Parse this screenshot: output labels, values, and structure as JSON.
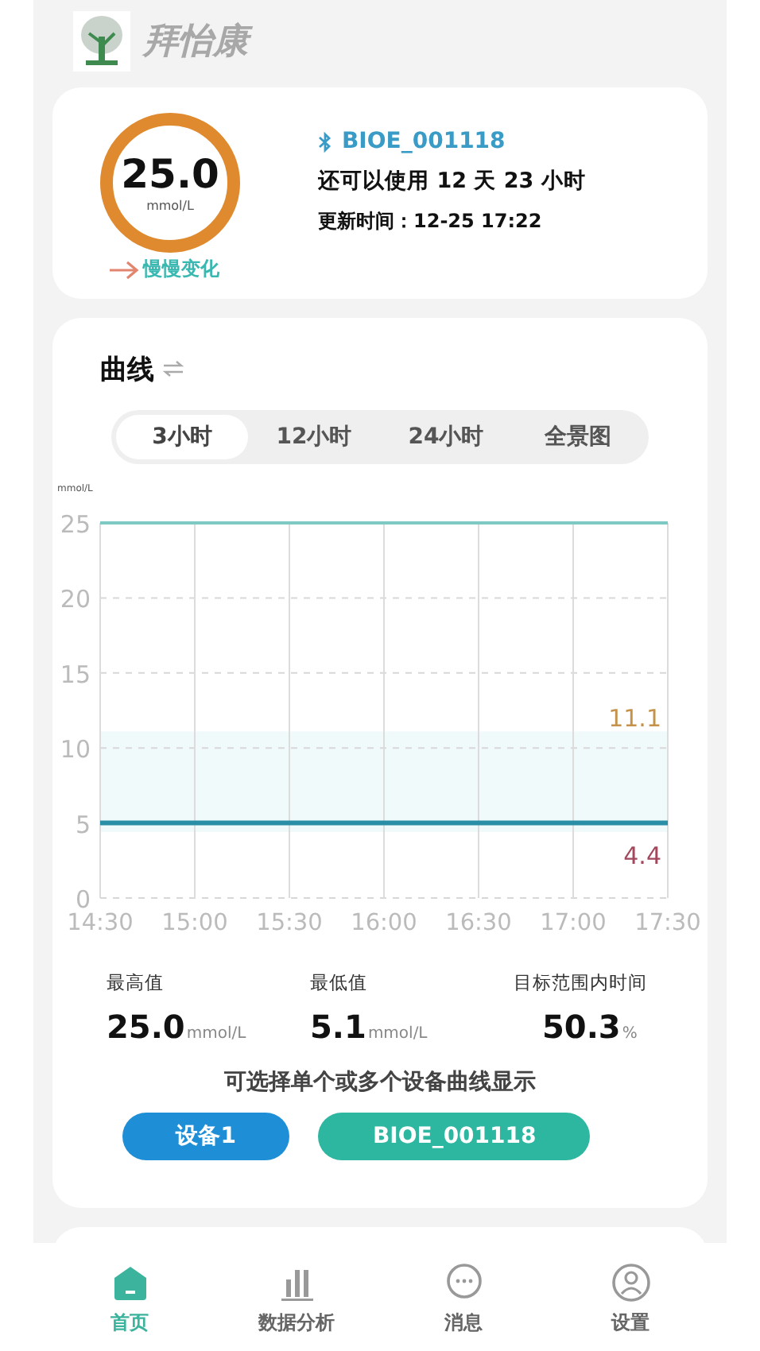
{
  "app": {
    "title": "拜怡康"
  },
  "reading": {
    "value": "25.0",
    "unit": "mmol/L",
    "trend": "慢慢变化",
    "device": "BIOE_001118",
    "remaining": "还可以使用 12 天 23 小时",
    "updated": "更新时间：12-25 17:22"
  },
  "curve": {
    "title": "曲线",
    "tabs": [
      {
        "label": "3小时",
        "selected": true
      },
      {
        "label": "12小时",
        "selected": false
      },
      {
        "label": "24小时",
        "selected": false
      },
      {
        "label": "全景图",
        "selected": false
      }
    ],
    "chart_data": {
      "type": "line",
      "ylabel": "mmol/L",
      "categories": [
        "14:30",
        "15:00",
        "15:30",
        "16:00",
        "16:30",
        "17:00",
        "17:30"
      ],
      "ylim": [
        0,
        25
      ],
      "yticks": [
        0,
        5,
        10,
        15,
        20,
        25
      ],
      "series": [
        {
          "color": "#7fc9c5",
          "values": [
            25,
            25,
            25,
            25,
            25,
            25,
            25
          ]
        },
        {
          "color": "#2a8fa6",
          "values": [
            5,
            5,
            5,
            5,
            5,
            5,
            5
          ]
        }
      ],
      "grid": true,
      "bands": [
        {
          "axis": "y",
          "from": 4.4,
          "to": 11.1
        }
      ],
      "annotations": [
        "11.1",
        "4.4"
      ]
    },
    "stats": [
      {
        "label": "最高值",
        "value": "25.0",
        "unit": "mmol/L"
      },
      {
        "label": "最低值",
        "value": "5.1",
        "unit": "mmol/L"
      },
      {
        "label": "目标范围内时间",
        "value": "50.3",
        "unit": "%"
      }
    ],
    "hint": "可选择单个或多个设备曲线显示",
    "devices": [
      {
        "label": "设备1",
        "color": "#1e8fd6"
      },
      {
        "label": "BIOE_001118",
        "color": "#2db6a0"
      }
    ]
  },
  "nav": [
    {
      "label": "首页",
      "selected": true
    },
    {
      "label": "数据分析",
      "selected": false
    },
    {
      "label": "消息",
      "selected": false
    },
    {
      "label": "设置",
      "selected": false
    }
  ]
}
